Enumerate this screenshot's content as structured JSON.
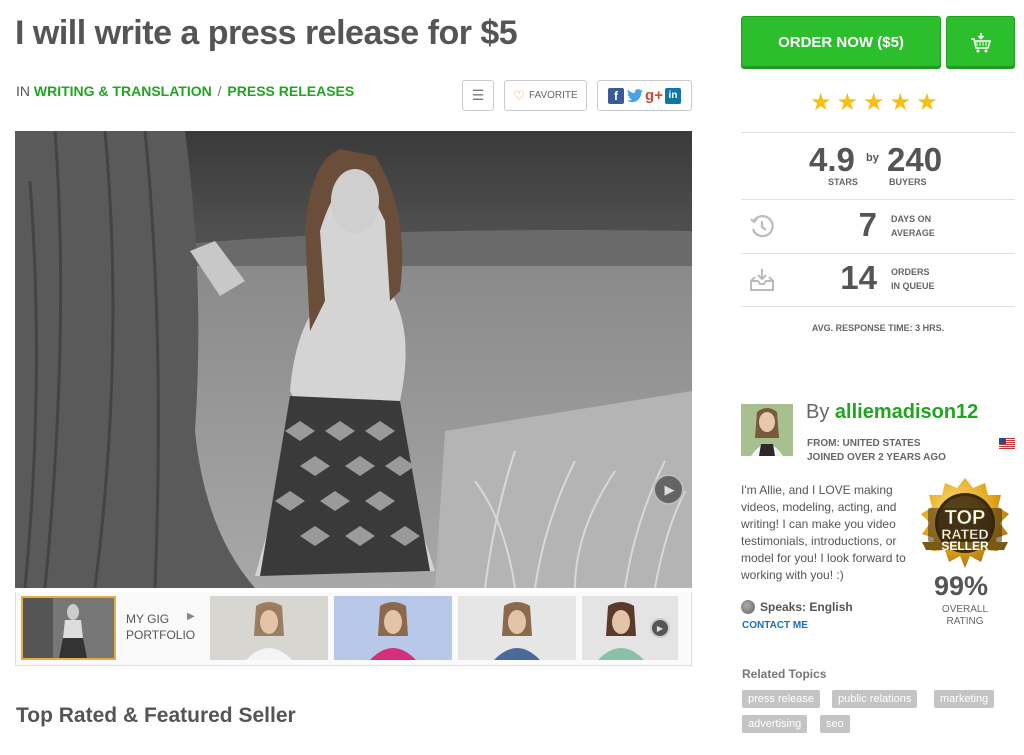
{
  "gig": {
    "title": "I will write a press release for $5",
    "breadcrumb_prefix": "IN",
    "category": "WRITING & TRANSLATION",
    "separator": "/",
    "subcategory": "PRESS RELEASES"
  },
  "actions": {
    "menu_icon": "menu-lines-icon",
    "favorite_label": "FAVORITE",
    "share_icons": [
      "facebook-icon",
      "twitter-icon",
      "google-plus-icon",
      "linkedin-icon"
    ]
  },
  "media": {
    "portfolio_label_line1": "MY GIG",
    "portfolio_label_line2": "PORTFOLIO"
  },
  "order": {
    "button_label": "ORDER NOW ($5)",
    "cart_icon": "cart-icon"
  },
  "rating": {
    "stars_count": 5,
    "score": "4.9",
    "by": "by",
    "buyers": "240",
    "stars_label": "STARS",
    "buyers_label": "BUYERS"
  },
  "stats": {
    "delivery_days": "7",
    "delivery_label1": "DAYS ON",
    "delivery_label2": "AVERAGE",
    "queue_orders": "14",
    "queue_label1": "ORDERS",
    "queue_label2": "IN QUEUE",
    "response_time": "AVG. RESPONSE TIME: 3 HRS."
  },
  "seller": {
    "by_prefix": "By",
    "username": "alliemadison12",
    "from": "FROM: UNITED STATES",
    "joined": "JOINED OVER 2 YEARS AGO",
    "bio": "I'm Allie, and I LOVE making videos, modeling, acting, and writing! I can make you video testimonials, introductions, or model for you! I look forward to working with you! :)",
    "badge_line1": "TOP",
    "badge_line2": "RATED",
    "badge_line3": "SELLER",
    "rating_pct": "99%",
    "rating_label1": "OVERALL",
    "rating_label2": "RATING",
    "speaks": "Speaks: English",
    "contact": "CONTACT ME"
  },
  "related": {
    "title": "Related Topics",
    "tags": [
      "press release",
      "public relations",
      "marketing",
      "advertising",
      "seo"
    ]
  },
  "section": {
    "heading": "Top Rated & Featured Seller"
  },
  "colors": {
    "accent_green": "#1fa51f",
    "button_green": "#2dbe2d",
    "star_gold": "#f5c015",
    "link_blue": "#1a6fb5"
  }
}
